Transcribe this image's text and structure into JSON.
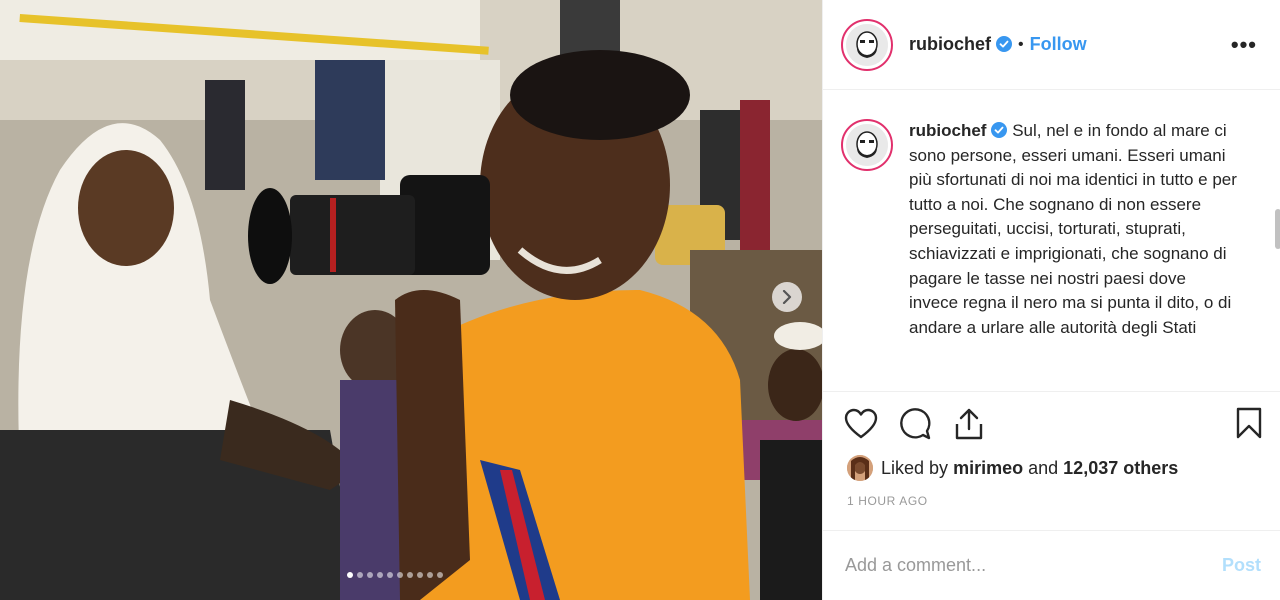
{
  "header": {
    "username": "rubiochef",
    "separator": "•",
    "follow_label": "Follow",
    "more_label": "•••"
  },
  "caption": {
    "username": "rubiochef",
    "text": "Sul, nel e in fondo al mare ci sono persone, esseri umani. Esseri umani più sfortunati di noi ma identici in tutto e per tutto a noi. Che sognano di non essere perseguitati, uccisi, torturati, stuprati, schiavizzati e imprigionati, che sognano di pagare le tasse nei nostri paesi dove invece regna il nero ma si punta il dito, o di andare a urlare alle autorità degli Stati"
  },
  "likes": {
    "prefix": "Liked by",
    "user": "mirimeo",
    "middle": "and",
    "count": "12,037 others"
  },
  "timestamp": "1 HOUR AGO",
  "comment": {
    "placeholder": "Add a comment...",
    "post_label": "Post"
  },
  "carousel": {
    "total": 10,
    "active_index": 0
  },
  "colors": {
    "accent": "#3897f0",
    "verified": "#3897f0",
    "post_disabled": "#b2dffc"
  }
}
